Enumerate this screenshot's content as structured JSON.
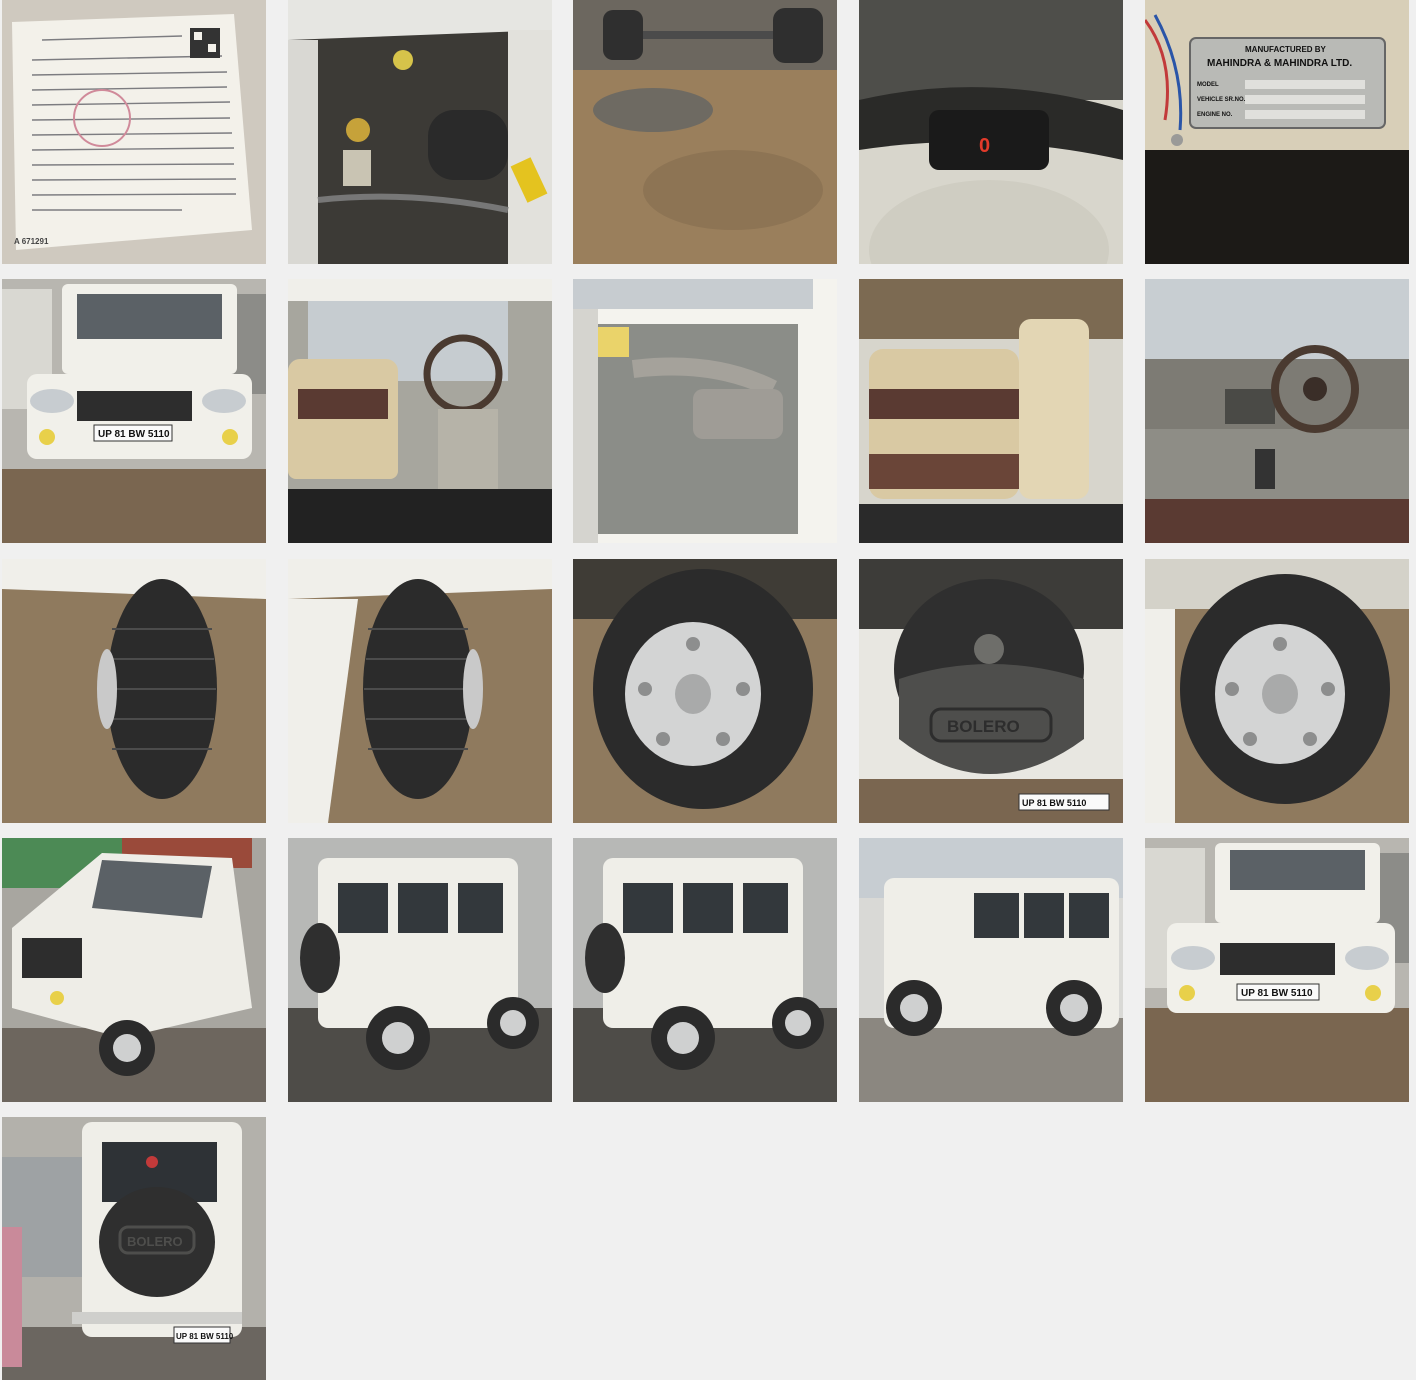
{
  "gallery": {
    "photos": [
      {
        "subject": "registration-certificate",
        "caption": "",
        "texts": [
          "A 671291"
        ]
      },
      {
        "subject": "engine-bay",
        "caption": "",
        "texts": []
      },
      {
        "subject": "underbody",
        "caption": "",
        "texts": []
      },
      {
        "subject": "instrument-cluster",
        "caption": "",
        "texts": []
      },
      {
        "subject": "manufacturer-plate",
        "caption": "",
        "texts": [
          "MANUFACTURED BY",
          "MAHINDRA & MAHINDRA LTD.",
          "MODEL",
          "VEHICLE SR.NO.",
          "ENGINE NO."
        ]
      },
      {
        "subject": "front-view",
        "caption": "",
        "texts": [
          "UP 81 BW 5110"
        ]
      },
      {
        "subject": "driver-cabin",
        "caption": "",
        "texts": []
      },
      {
        "subject": "door-panel",
        "caption": "",
        "texts": []
      },
      {
        "subject": "rear-seats",
        "caption": "",
        "texts": []
      },
      {
        "subject": "dashboard",
        "caption": "",
        "texts": []
      },
      {
        "subject": "front-tyre-left",
        "caption": "",
        "texts": []
      },
      {
        "subject": "front-tyre-right",
        "caption": "",
        "texts": []
      },
      {
        "subject": "rear-wheel",
        "caption": "",
        "texts": []
      },
      {
        "subject": "spare-wheel",
        "caption": "",
        "texts": [
          "BOLERO",
          "UP 81 BW 5110"
        ]
      },
      {
        "subject": "rear-wheel-right",
        "caption": "",
        "texts": []
      },
      {
        "subject": "front-three-quarter",
        "caption": "",
        "texts": []
      },
      {
        "subject": "rear-three-quarter",
        "caption": "",
        "texts": []
      },
      {
        "subject": "rear-three-quarter-2",
        "caption": "",
        "texts": []
      },
      {
        "subject": "side-view",
        "caption": "",
        "texts": []
      },
      {
        "subject": "front-view-2",
        "caption": "",
        "texts": [
          "UP 81 BW 5110"
        ]
      },
      {
        "subject": "rear-view",
        "caption": "",
        "texts": [
          "BOLERO",
          "UP 81 BW 5110"
        ]
      }
    ]
  },
  "colors": {
    "page_bg": "#f0f0f0",
    "vehicle_white": "#ecebe4",
    "ground": "#8b7558",
    "tyre": "#2b2b2b",
    "seat_cream": "#d9c9a3",
    "seat_brown": "#5a3a32",
    "plate_yellow": "#e8d04a",
    "dash_grey": "#9a9a92"
  }
}
